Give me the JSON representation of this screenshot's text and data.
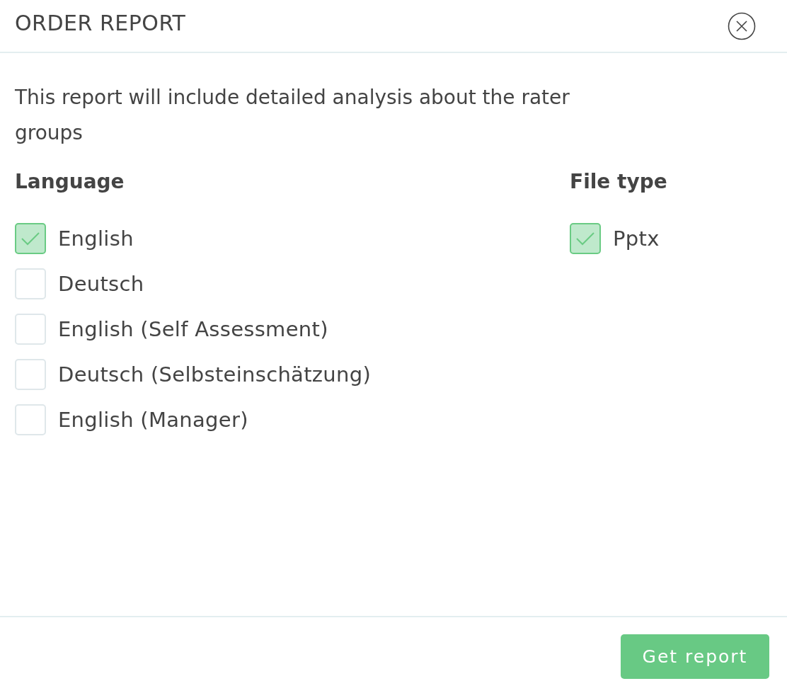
{
  "dialog": {
    "title": "ORDER REPORT"
  },
  "description": "This report will include detailed analysis about the rater groups",
  "language": {
    "heading": "Language",
    "options": [
      {
        "label": "English",
        "checked": true
      },
      {
        "label": "Deutsch",
        "checked": false
      },
      {
        "label": "English (Self Assessment)",
        "checked": false
      },
      {
        "label": "Deutsch (Selbsteinschätzung)",
        "checked": false
      },
      {
        "label": "English (Manager)",
        "checked": false
      }
    ]
  },
  "file_type": {
    "heading": "File type",
    "options": [
      {
        "label": "Pptx",
        "checked": true
      }
    ]
  },
  "footer": {
    "button": "Get report"
  }
}
